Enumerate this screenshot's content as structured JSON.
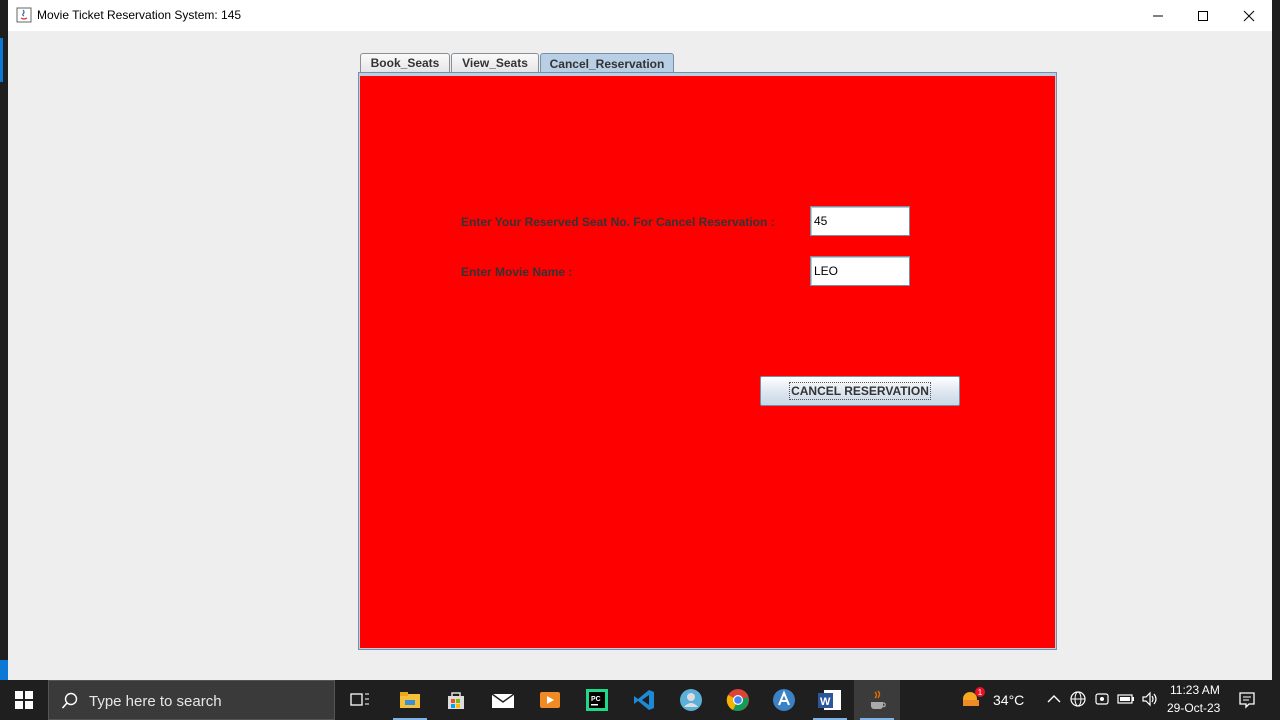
{
  "window": {
    "title": "Movie Ticket Reservation System: 145"
  },
  "tabs": [
    {
      "label": "Book_Seats",
      "selected": false
    },
    {
      "label": "View_Seats",
      "selected": false
    },
    {
      "label": "Cancel_Reservation",
      "selected": true
    }
  ],
  "cancel_form": {
    "seat_label": "Enter Your Reserved Seat No. For Cancel Reservation :",
    "seat_value": "45",
    "movie_label": "Enter Movie Name :",
    "movie_value": "LEO",
    "submit_label": "CANCEL RESERVATION",
    "panel_color": "#ff0000"
  },
  "taskbar": {
    "search_placeholder": "Type here to search",
    "apps": [
      "task-view-icon",
      "file-explorer-icon",
      "store-icon",
      "mail-icon",
      "media-player-icon",
      "pycharm-icon",
      "vscode-icon",
      "contacts-icon",
      "chrome-icon",
      "app-icon",
      "word-icon",
      "java-app-icon"
    ],
    "weather_temp": "34°C",
    "weather_badge": "1",
    "clock_time": "11:23 AM",
    "clock_date": "29-Oct-23"
  }
}
